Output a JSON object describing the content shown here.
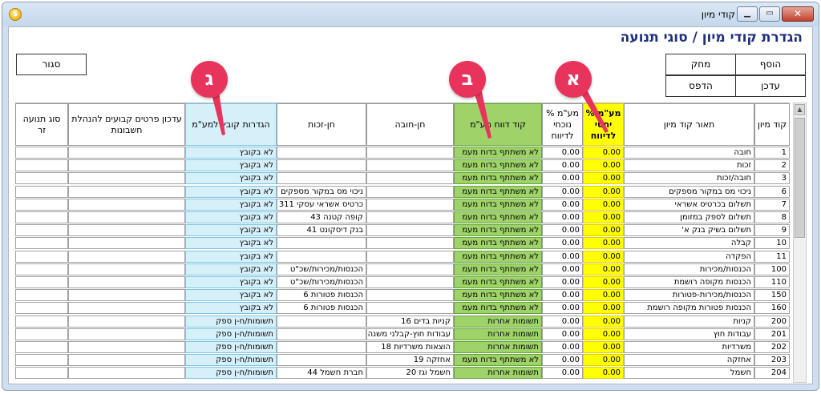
{
  "window": {
    "title": "קודי מיון"
  },
  "form": {
    "title": "הגדרת קודי מיון / סוגי תנועה"
  },
  "buttons": {
    "add": "הוסף",
    "delete": "מחק",
    "update": "עדכן",
    "print": "הדפס",
    "close": "סגור"
  },
  "callouts": {
    "a": "א",
    "b": "ב",
    "g": "ג"
  },
  "colors": {
    "vat_actual": "#ffff00",
    "vat_report_code": "#9fd36a",
    "vat_file_settings": "#d6f0fa",
    "callout": "#e8345c",
    "title": "#1f2f7a"
  },
  "table": {
    "headers": {
      "code": "קוד מיון",
      "desc": "תאור קוד מיון",
      "vat_actual": "% מע\"מ יחסי לדיווח",
      "vat_deduct": "% מע\"מ נוכחי לדיווח",
      "vat_report_code": "קוד דווח מע\"מ",
      "debit": "חן-חובה",
      "credit": "חן-זכות",
      "vat_file": "הגדרות קובץ למע\"מ",
      "fixed_details": "עדכון פרטים קבועים להנהלת חשבונות",
      "foreign_type": "סוג תנועה זר"
    },
    "rows": [
      {
        "code": "1",
        "desc": "חובה",
        "va": "0.00",
        "vd": "0.00",
        "rc": "לא משתתף בדוח מעמ",
        "debit": "",
        "credit": "",
        "vf": "לא בקובץ"
      },
      {
        "code": "2",
        "desc": "זכות",
        "va": "0.00",
        "vd": "0.00",
        "rc": "לא משתתף בדוח מעמ",
        "debit": "",
        "credit": "",
        "vf": "לא בקובץ"
      },
      {
        "code": "3",
        "desc": "חובה/זכות",
        "va": "0.00",
        "vd": "0.00",
        "rc": "לא משתתף בדוח מעמ",
        "debit": "",
        "credit": "",
        "vf": "לא בקובץ"
      },
      {
        "code": "6",
        "desc": "ניכוי מס במקור מספקים",
        "va": "0.00",
        "vd": "0.00",
        "rc": "לא משתתף בדוח מעמ",
        "debit": "",
        "credit": "ניכוי מס במקור מספקים",
        "vf": "לא בקובץ"
      },
      {
        "code": "7",
        "desc": "תשלום בכרטיס אשראי",
        "va": "0.00",
        "vd": "0.00",
        "rc": "לא משתתף בדוח מעמ",
        "debit": "",
        "credit": "כרטיס אשראי עסקי 311",
        "vf": "לא בקובץ"
      },
      {
        "code": "8",
        "desc": "תשלום לספק במזומן",
        "va": "0.00",
        "vd": "0.00",
        "rc": "לא משתתף בדוח מעמ",
        "debit": "",
        "credit": "קופה קטנה 43",
        "vf": "לא בקובץ"
      },
      {
        "code": "9",
        "desc": "תשלום בשיק בנק א'",
        "va": "0.00",
        "vd": "0.00",
        "rc": "לא משתתף בדוח מעמ",
        "debit": "",
        "credit": "בנק דיסקונט 41",
        "vf": "לא בקובץ"
      },
      {
        "code": "10",
        "desc": "קבלה",
        "va": "0.00",
        "vd": "0.00",
        "rc": "לא משתתף בדוח מעמ",
        "debit": "",
        "credit": "",
        "vf": "לא בקובץ"
      },
      {
        "code": "11",
        "desc": "הפקדה",
        "va": "0.00",
        "vd": "0.00",
        "rc": "לא משתתף בדוח מעמ",
        "debit": "",
        "credit": "",
        "vf": "לא בקובץ"
      },
      {
        "code": "100",
        "desc": "הכנסות/מכירות",
        "va": "0.00",
        "vd": "0.00",
        "rc": "לא משתתף בדוח מעמ",
        "debit": "",
        "credit": "הכנסות/מכירות/שכ\"ט",
        "vf": "לא בקובץ"
      },
      {
        "code": "110",
        "desc": "הכנסות מקופה רושמת",
        "va": "0.00",
        "vd": "0.00",
        "rc": "לא משתתף בדוח מעמ",
        "debit": "",
        "credit": "הכנסות/מכירות/שכ\"ט",
        "vf": "לא בקובץ"
      },
      {
        "code": "150",
        "desc": "הכנסות/מכירות-פטורות",
        "va": "0.00",
        "vd": "0.00",
        "rc": "לא משתתף בדוח מעמ",
        "debit": "",
        "credit": "הכנסות פטורות 6",
        "vf": "לא בקובץ"
      },
      {
        "code": "160",
        "desc": "הכנסות פטורות מקופה רושמת",
        "va": "0.00",
        "vd": "0.00",
        "rc": "לא משתתף בדוח מעמ",
        "debit": "",
        "credit": "הכנסות פטורות 6",
        "vf": "לא בקובץ"
      },
      {
        "code": "200",
        "desc": "קניות",
        "va": "0.00",
        "vd": "0.00",
        "rc": "תשומות אחרות",
        "debit": "קניות בדים 16",
        "credit": "",
        "vf": "תשומות/ח-ן ספק"
      },
      {
        "code": "201",
        "desc": "עבודות חוץ",
        "va": "0.00",
        "vd": "0.00",
        "rc": "תשומות אחרות",
        "debit": "עבודות חוץ-קבלני משנה",
        "credit": "",
        "vf": "תשומות/ח-ן ספק"
      },
      {
        "code": "202",
        "desc": "משרדיות",
        "va": "0.00",
        "vd": "0.00",
        "rc": "תשומות אחרות",
        "debit": "הוצאות משרדיות 18",
        "credit": "",
        "vf": "תשומות/ח-ן ספק"
      },
      {
        "code": "203",
        "desc": "אחזקה",
        "va": "0.00",
        "vd": "0.00",
        "rc": "לא משתתף בדוח מעמ",
        "debit": "אחזקה 19",
        "credit": "",
        "vf": "תשומות/ח-ן ספק"
      },
      {
        "code": "204",
        "desc": "חשמל",
        "va": "0.00",
        "vd": "0.00",
        "rc": "תשומות אחרות",
        "debit": "חשמל וגז 20",
        "credit": "חברת חשמל 44",
        "vf": "תשומות/ח-ן ספק"
      }
    ]
  }
}
